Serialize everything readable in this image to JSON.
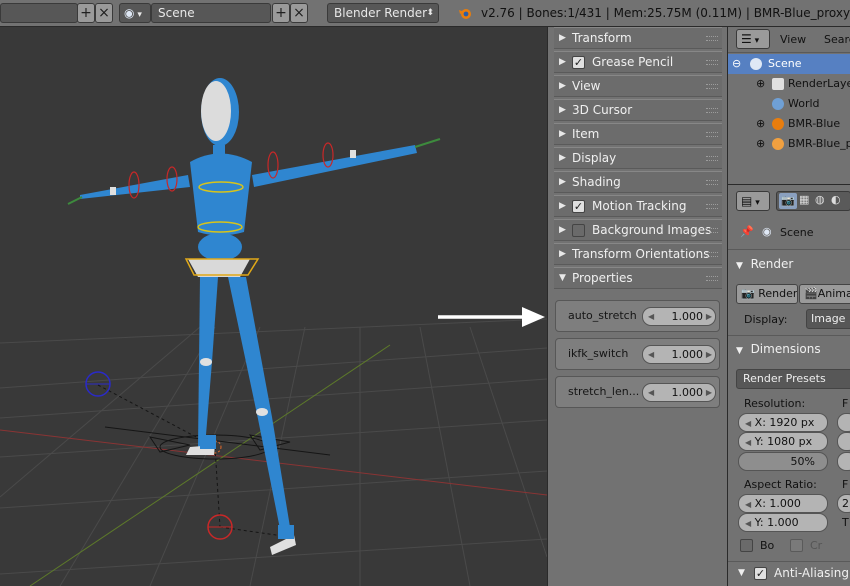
{
  "header": {
    "scene_icon": "scene-icon",
    "scene_name": "Scene",
    "render_engine": "Blender Render",
    "status": "v2.76 | Bones:1/431 | Mem:25.75M (0.11M) | BMR-Blue_proxy"
  },
  "npanel": {
    "sections": [
      {
        "label": "Transform",
        "check": null
      },
      {
        "label": "Grease Pencil",
        "check": true
      },
      {
        "label": "View",
        "check": null
      },
      {
        "label": "3D Cursor",
        "check": null
      },
      {
        "label": "Item",
        "check": null
      },
      {
        "label": "Display",
        "check": null
      },
      {
        "label": "Shading",
        "check": null
      },
      {
        "label": "Motion Tracking",
        "check": true
      },
      {
        "label": "Background Images",
        "check": false
      },
      {
        "label": "Transform Orientations",
        "check": null
      },
      {
        "label": "Properties",
        "check": null
      }
    ],
    "properties": [
      {
        "name": "auto_stretch",
        "value": "1.000"
      },
      {
        "name": "ikfk_switch",
        "value": "1.000"
      },
      {
        "name": "stretch_len...",
        "value": "1.000"
      }
    ]
  },
  "outliner": {
    "view_label": "View",
    "search_label": "Searc",
    "items": [
      {
        "label": "Scene",
        "expand": "⊖",
        "icon": "scene-icon"
      },
      {
        "label": "RenderLayers",
        "expand": "⊕",
        "icon": "render-layers-icon"
      },
      {
        "label": "World",
        "expand": "",
        "icon": "world-icon"
      },
      {
        "label": "BMR-Blue",
        "expand": "⊕",
        "icon": "armature-icon"
      },
      {
        "label": "BMR-Blue_proxy",
        "expand": "⊕",
        "icon": "armature-proxy-icon"
      }
    ]
  },
  "properties_editor": {
    "context": "Scene",
    "render_section": "Render",
    "render_button": "Render",
    "animation_button": "Animati",
    "display_label": "Display:",
    "display_value": "Image E",
    "dimensions_section": "Dimensions",
    "render_presets": "Render Presets",
    "resolution_label": "Resolution:",
    "res_x": "X:  1920 px",
    "res_y": "Y:  1080 px",
    "res_pct": "50%",
    "aspect_label": "Aspect Ratio:",
    "aspect_x": "X:  1.000",
    "aspect_y": "Y:  1.000",
    "border_label": "Bo",
    "crop_label": "Cr",
    "anti_aliasing": "Anti-Aliasing",
    "frame_col_labels": [
      "F",
      "F",
      "T"
    ],
    "frame_value": "2"
  },
  "colors": {
    "accent_blue": "#2f86d0",
    "selected_row": "#5680c2",
    "panel_bg": "#727272",
    "viewport_bg": "#393939"
  }
}
